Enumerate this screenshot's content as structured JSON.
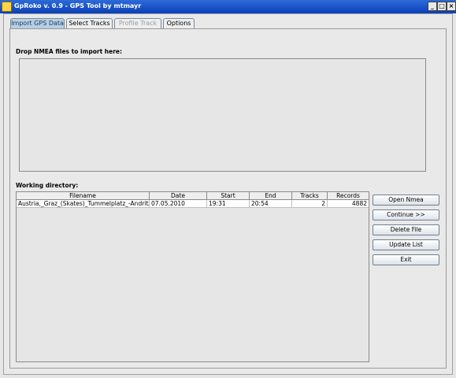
{
  "window": {
    "title": "GpRoko v. 0.9 - GPS Tool by mtmayr",
    "controls": {
      "minimize": "_",
      "maximize": "□",
      "close": "×"
    }
  },
  "tabs": [
    {
      "label": "Import GPS Data",
      "state": "active"
    },
    {
      "label": "Select Tracks",
      "state": "enabled"
    },
    {
      "label": "Profile Track",
      "state": "disabled"
    },
    {
      "label": "Options",
      "state": "enabled"
    }
  ],
  "import": {
    "drop_label": "Drop NMEA files to import here:",
    "working_dir_label": "Working directory:"
  },
  "table": {
    "columns": [
      "Filename",
      "Date",
      "Start",
      "End",
      "Tracks",
      "Records"
    ],
    "rows": [
      [
        "Austria,_Graz_(Skates)_Tummelplatz_-Andritz-Goe...",
        "07.05.2010",
        "19:31",
        "20:54",
        "2",
        "4882"
      ]
    ]
  },
  "buttons": {
    "open": "Open Nmea",
    "continue": "Continue >>",
    "delete": "Delete File",
    "update": "Update List",
    "exit": "Exit"
  },
  "colors": {
    "titlebar": "#0a3fb8",
    "active_tab": "#b8cfe5",
    "background": "#e9e9e9"
  }
}
